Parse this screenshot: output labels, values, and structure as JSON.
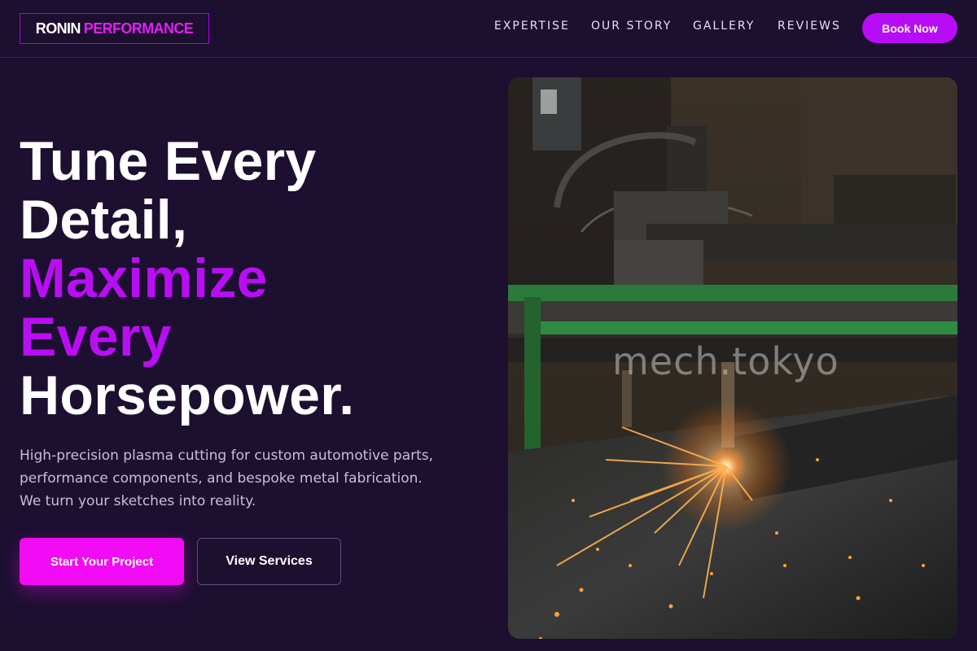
{
  "brand": {
    "part1": "RONIN",
    "part2": "PERFORMANCE",
    "accent_color": "#e020f0"
  },
  "nav": {
    "items": [
      "EXPERTISE",
      "OUR STORY",
      "GALLERY",
      "REVIEWS"
    ],
    "cta_label": "Book Now"
  },
  "hero": {
    "headline_lines": [
      "Tune Every",
      "Detail,",
      "Maximize",
      "Every",
      "Horsepower."
    ],
    "subtext_lines": [
      "High-precision plasma cutting for custom automotive parts,",
      "performance components, and bespoke metal fabrication.",
      "We turn your sketches into reality."
    ],
    "primary_cta": "Start Your Project",
    "secondary_cta": "View Services",
    "image_watermark": "mech.tokyo"
  },
  "colors": {
    "background": "#1c0f30",
    "purple": "#b90ef4",
    "magenta_button": "#f20bf5",
    "book_button": "#b70cf5"
  }
}
